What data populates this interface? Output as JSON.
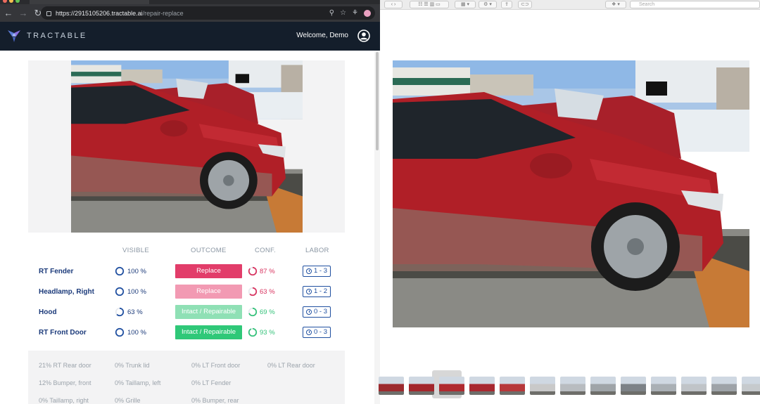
{
  "browser": {
    "url_host": "https://2915105206.tractable.ai",
    "url_path": "/repair-replace"
  },
  "app": {
    "brand": "TRACTABLE",
    "welcome": "Welcome, Demo"
  },
  "table": {
    "headers": {
      "visible": "VISIBLE",
      "outcome": "OUTCOME",
      "conf": "CONF.",
      "labor": "LABOR"
    },
    "rows": [
      {
        "part": "RT Fender",
        "visible": "100 %",
        "visible_fraction": 1.0,
        "outcome": "Replace",
        "outcome_color": "#e23d6a",
        "conf": "87 %",
        "conf_fraction": 0.87,
        "conf_color": "#d8335f",
        "labor": "1 - 3"
      },
      {
        "part": "Headlamp, Right",
        "visible": "100 %",
        "visible_fraction": 1.0,
        "outcome": "Replace",
        "outcome_color": "#f29ab3",
        "conf": "63 %",
        "conf_fraction": 0.63,
        "conf_color": "#d8335f",
        "labor": "1 - 2"
      },
      {
        "part": "Hood",
        "visible": "63 %",
        "visible_fraction": 0.63,
        "outcome": "Intact / Repairable",
        "outcome_color": "#8fe0b5",
        "conf": "69 %",
        "conf_fraction": 0.69,
        "conf_color": "#34c27a",
        "labor": "0 - 3"
      },
      {
        "part": "RT Front Door",
        "visible": "100 %",
        "visible_fraction": 1.0,
        "outcome": "Intact / Repairable",
        "outcome_color": "#2fc878",
        "conf": "93 %",
        "conf_fraction": 0.93,
        "conf_color": "#34c27a",
        "labor": "0 - 3"
      }
    ]
  },
  "other_parts": [
    "21% RT Rear door",
    "0% Trunk lid",
    "0% LT Front door",
    "0% LT Rear door",
    "12% Bumper, front",
    "0% Taillamp, left",
    "0% LT Fender",
    "0% Taillamp, right",
    "0% Grille",
    "0% Bumper, rear"
  ],
  "viewer": {
    "search_placeholder": "Search",
    "thumbnail_count": 13,
    "selected_thumbnail": 3
  },
  "colors": {
    "appbar": "#141e2b",
    "label_blue": "#1b3a7a",
    "labor_blue": "#1f4fa0"
  }
}
